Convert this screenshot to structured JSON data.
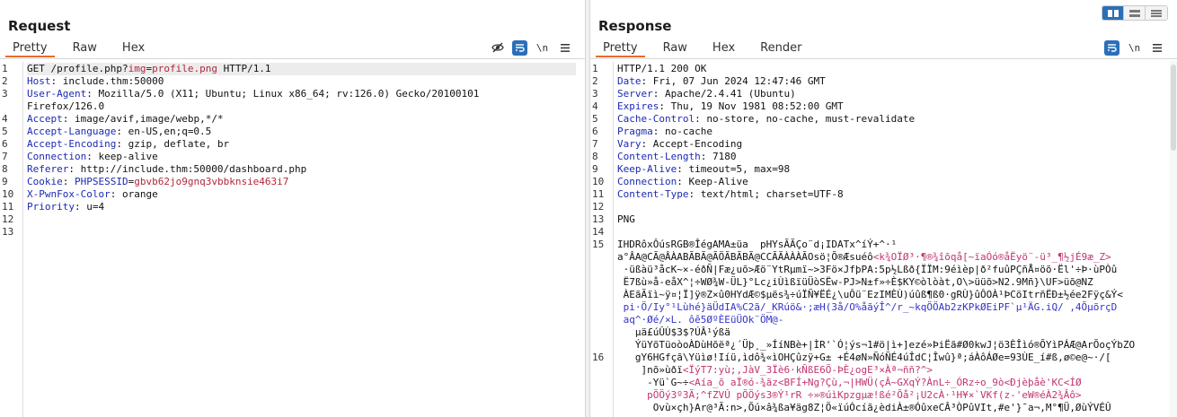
{
  "request": {
    "title": "Request",
    "tabs": [
      "Pretty",
      "Raw",
      "Hex"
    ],
    "active_tab": "Pretty",
    "toolbar": {
      "hide_icon": "eye-off-icon",
      "wrap_icon": "wrap-icon",
      "newline_label": "\\n",
      "menu_icon": "menu-icon"
    },
    "line_numbers": [
      "1",
      "2",
      "3",
      "",
      "4",
      "5",
      "6",
      "7",
      "8",
      "9",
      "10",
      "11",
      "12",
      "13"
    ],
    "lines": [
      {
        "parts": [
          [
            "",
            "GET /profile.php?"
          ],
          [
            "pv",
            "img"
          ],
          [
            "",
            "="
          ],
          [
            "pv",
            "profile.png"
          ],
          [
            "",
            " HTTP/1.1"
          ]
        ]
      },
      {
        "parts": [
          [
            "hk",
            "Host"
          ],
          [
            "",
            ": include.thm:50000"
          ]
        ]
      },
      {
        "parts": [
          [
            "hk",
            "User-Agent"
          ],
          [
            "",
            ": Mozilla/5.0 (X11; Ubuntu; Linux x86_64; rv:126.0) Gecko/20100101"
          ]
        ]
      },
      {
        "parts": [
          [
            "",
            "Firefox/126.0"
          ]
        ]
      },
      {
        "parts": [
          [
            "hk",
            "Accept"
          ],
          [
            "",
            ": image/avif,image/webp,*/*"
          ]
        ]
      },
      {
        "parts": [
          [
            "hk",
            "Accept-Language"
          ],
          [
            "",
            ": en-US,en;q=0.5"
          ]
        ]
      },
      {
        "parts": [
          [
            "hk",
            "Accept-Encoding"
          ],
          [
            "",
            ": gzip, deflate, br"
          ]
        ]
      },
      {
        "parts": [
          [
            "hk",
            "Connection"
          ],
          [
            "",
            ": keep-alive"
          ]
        ]
      },
      {
        "parts": [
          [
            "hk",
            "Referer"
          ],
          [
            "",
            ": http://include.thm:50000/dashboard.php"
          ]
        ]
      },
      {
        "parts": [
          [
            "hk",
            "Cookie"
          ],
          [
            "",
            ": "
          ],
          [
            "hk",
            "PHPSESSID"
          ],
          [
            "",
            "="
          ],
          [
            "pv",
            "gbvb62jo9gnq3vbbknsie463i7"
          ]
        ]
      },
      {
        "parts": [
          [
            "hk",
            "X-PwnFox-Color"
          ],
          [
            "",
            ": orange"
          ]
        ]
      },
      {
        "parts": [
          [
            "hk",
            "Priority"
          ],
          [
            "",
            ": u=4"
          ]
        ]
      },
      {
        "parts": [
          [
            "",
            ""
          ]
        ]
      },
      {
        "parts": [
          [
            "",
            ""
          ]
        ]
      }
    ]
  },
  "response": {
    "title": "Response",
    "tabs": [
      "Pretty",
      "Raw",
      "Hex",
      "Render"
    ],
    "active_tab": "Pretty",
    "toolbar": {
      "wrap_icon": "wrap-icon",
      "newline_label": "\\n",
      "menu_icon": "menu-icon"
    },
    "line_numbers": [
      "1",
      "2",
      "3",
      "4",
      "5",
      "6",
      "7",
      "8",
      "9",
      "10",
      "11",
      "12",
      "13",
      "14",
      "15",
      "",
      "",
      "",
      "",
      "",
      "",
      "",
      "",
      "16",
      "",
      "",
      "",
      "",
      "",
      "",
      "",
      "",
      ""
    ],
    "lines": [
      {
        "parts": [
          [
            "",
            "HTTP/1.1 200 OK"
          ]
        ]
      },
      {
        "parts": [
          [
            "hk",
            "Date"
          ],
          [
            "",
            ": Fri, 07 Jun 2024 12:47:46 GMT"
          ]
        ]
      },
      {
        "parts": [
          [
            "hk",
            "Server"
          ],
          [
            "",
            ": Apache/2.4.41 (Ubuntu)"
          ]
        ]
      },
      {
        "parts": [
          [
            "hk",
            "Expires"
          ],
          [
            "",
            ": Thu, 19 Nov 1981 08:52:00 GMT"
          ]
        ]
      },
      {
        "parts": [
          [
            "hk",
            "Cache-Control"
          ],
          [
            "",
            ": no-store, no-cache, must-revalidate"
          ]
        ]
      },
      {
        "parts": [
          [
            "hk",
            "Pragma"
          ],
          [
            "",
            ": no-cache"
          ]
        ]
      },
      {
        "parts": [
          [
            "hk",
            "Vary"
          ],
          [
            "",
            ": Accept-Encoding"
          ]
        ]
      },
      {
        "parts": [
          [
            "hk",
            "Content-Length"
          ],
          [
            "",
            ": 7180"
          ]
        ]
      },
      {
        "parts": [
          [
            "hk",
            "Keep-Alive"
          ],
          [
            "",
            ": timeout=5, max=98"
          ]
        ]
      },
      {
        "parts": [
          [
            "hk",
            "Connection"
          ],
          [
            "",
            ": Keep-Alive"
          ]
        ]
      },
      {
        "parts": [
          [
            "hk",
            "Content-Type"
          ],
          [
            "",
            ": text/html; charset=UTF-8"
          ]
        ]
      },
      {
        "parts": [
          [
            "",
            ""
          ]
        ]
      },
      {
        "parts": [
          [
            "",
            "PNG"
          ]
        ]
      },
      {
        "parts": [
          [
            "",
            ""
          ]
        ]
      },
      {
        "parts": [
          [
            "",
            "IHDRôxÔúsRGB®ÎégAMA±üa  pHYsÃÃÇo¨d¡IDATx^íÝ+^·¹"
          ]
        ]
      },
      {
        "parts": [
          [
            "",
            "a°ÂA@CÃ@ÂÀABÃBÃ@ÃÖÃBÃBÃ@CCÃÃÀÀÀÃOsö¦Õ®Æsuéô"
          ],
          [
            "junk-r",
            "<k¾OÏØ³·¶®¾îõqå[~ïaÓó®åËyö¨-ü³_¶½jÉ9æ_Z>"
          ]
        ]
      },
      {
        "parts": [
          [
            "",
            " ·üßàü³åcK~×-éðÑ|Fæ¿uõ>Æö¨YtRµmï~>3Fö×JfþPA:5p½Lßð{ÏÏM:9éìèp|ð²fuûPÇñÅ¤öõ·Ël'÷Þ·ùPÒû"
          ]
        ]
      },
      {
        "parts": [
          [
            "",
            " Ë7ßù»å-eåX^¦÷WØ¾W-ÜL}°Lc¿iÙìßïüÜòSËw-PJ>N±f»÷È$KY©òlòàt,O\\>üüõ>N2.9Mñ}\\UF>üõ@NZ"
          ]
        ]
      },
      {
        "parts": [
          [
            "",
            " ÀEãÃïì~ÿ¤¦Ï]ÿ®Z×û0HYdÆ©$µës¾÷úÏÑ¥ËÉ¿\\uÔü¨EzIMÈÙ)úûß¶ß0·gRÙ}ûÔOÀ¹ÞCöItrñËÐ±½ée2Fÿç&Ý<"
          ]
        ]
      },
      {
        "parts": [
          [
            "junk-b",
            " pi·Ö/Iy°¹Lùhé}äÜdIA%C2ã/_KRúö&·;æH(3å/O%åãýÎ^/r_~kqÖÖAb2zKPkØEiPF`µ¹ÄG.iQ/ ,4ÕµõrçD"
          ]
        ]
      },
      {
        "parts": [
          [
            "junk-b",
            " aq^·Øé/×L. ôê5ØºÈEüÜOk¨ÖM@-"
          ]
        ]
      },
      {
        "parts": [
          [
            "",
            "   µä£úÛÙ$3$?ÚÂ¹ýßä"
          ]
        ]
      },
      {
        "parts": [
          [
            "",
            "   ÝüYõTüoòoÀDùHõëª¿´Üþ¸_»ÍíNBè+|ÌR'`Ó¦ýs¬1#ö|ì+]ezé»ÞiËã#Ø0kwJ¦ö3ÈÎìó®ÕYìPÁÆ@ArÕoçÝbZO"
          ]
        ]
      },
      {
        "parts": [
          [
            "",
            "   gY6HGfçã\\Yüìø!Iíü,ìdô¾«ìOHÇûzÿ+G± +É4øN»ÑóÑÉ4úÎdC¦Îwû}ª;áÀôÁØe=93ÙE_í#ß,ø©e@~·/["
          ]
        ]
      },
      {
        "parts": [
          [
            "",
            "    ]nõ»ùðï"
          ],
          [
            "junk-r",
            "<ÏýT7:yù;,JàV_3Ïè6·kÑßE6Õ-ÞÈ¿ogE³×Àª¬ññ?^>"
          ]
        ]
      },
      {
        "parts": [
          [
            "",
            "     -Yü`G~÷"
          ],
          [
            "junk-r",
            "<Aía_õ aÏ®ó-¾ãz<BFÍ+Ng?Çù,¬|HWÜ(çÂ~GXqÝ?ÀnL÷_ÓRz÷o_9ò<Ðjèþåè'KC<ÍØ"
          ]
        ]
      },
      {
        "parts": [
          [
            "junk-r",
            "     pÕÖý3º3Ã;^fZVÛ pÕÖýs3®Ý¹rR ÷»®úìKpzgµæ!ßé²Õå²¡U2cÀ·¹H¥×`VKf(z-'eW®éÀ2¾Âô>"
          ]
        ]
      },
      {
        "parts": [
          [
            "",
            "      Ovù×çh}Ar@³Ã:n>,Õú×â¾ßa¥äg8Z¦Ö«ïúÓcíã¿èdiÀ±®ÓûxeCÂ³ÒPûVIt,#e'}¯a¬,M°¶Ü,ØùÝVÉÛ"
          ]
        ]
      }
    ]
  },
  "layout_switch": {
    "buttons": [
      "split-horizontal-icon",
      "split-vertical-icon",
      "single-pane-icon"
    ],
    "active": 0
  }
}
